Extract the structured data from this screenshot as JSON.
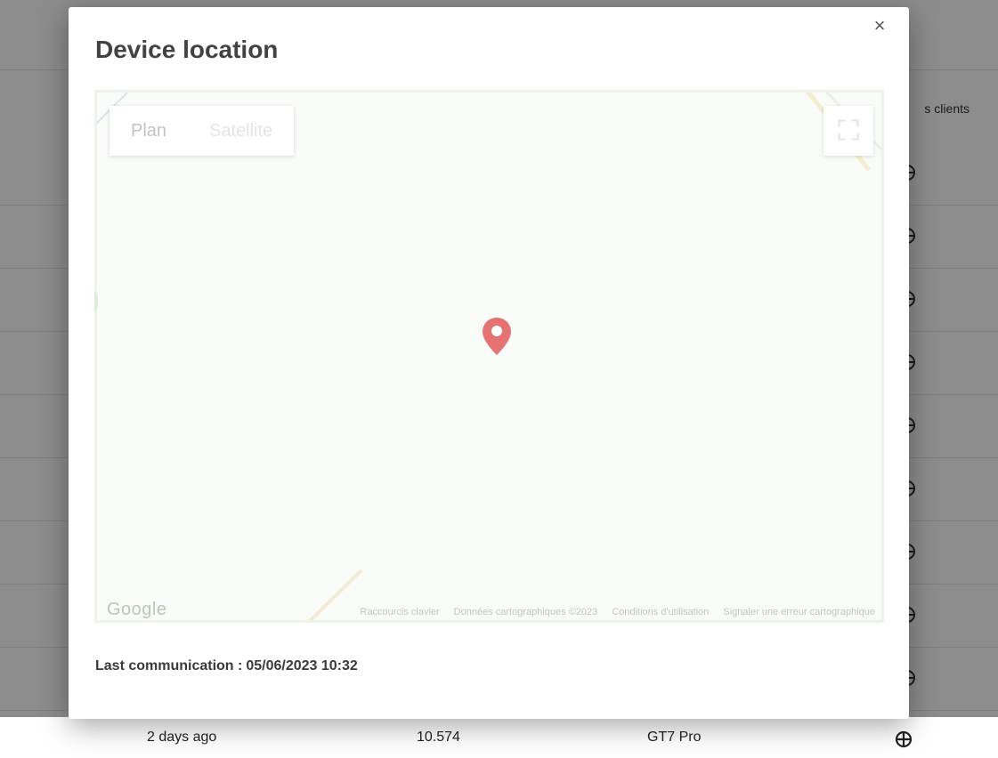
{
  "background": {
    "column_header": "s clients",
    "last_row": {
      "time": "2 days ago",
      "value": "10.574",
      "device": "GT7 Pro"
    }
  },
  "modal": {
    "title": "Device location",
    "close_symbol": "×",
    "map": {
      "type_options": [
        "Plan",
        "Satellite"
      ],
      "logo_text": "Google",
      "attribution": [
        "Raccourcis clavier",
        "Données cartographiques ©2023",
        "Conditions d'utilisation",
        "Signaler une erreur cartographique"
      ],
      "pin_color": "#e57373"
    },
    "last_communication_label": "Last communication :",
    "last_communication_value": "05/06/2023 10:32"
  }
}
